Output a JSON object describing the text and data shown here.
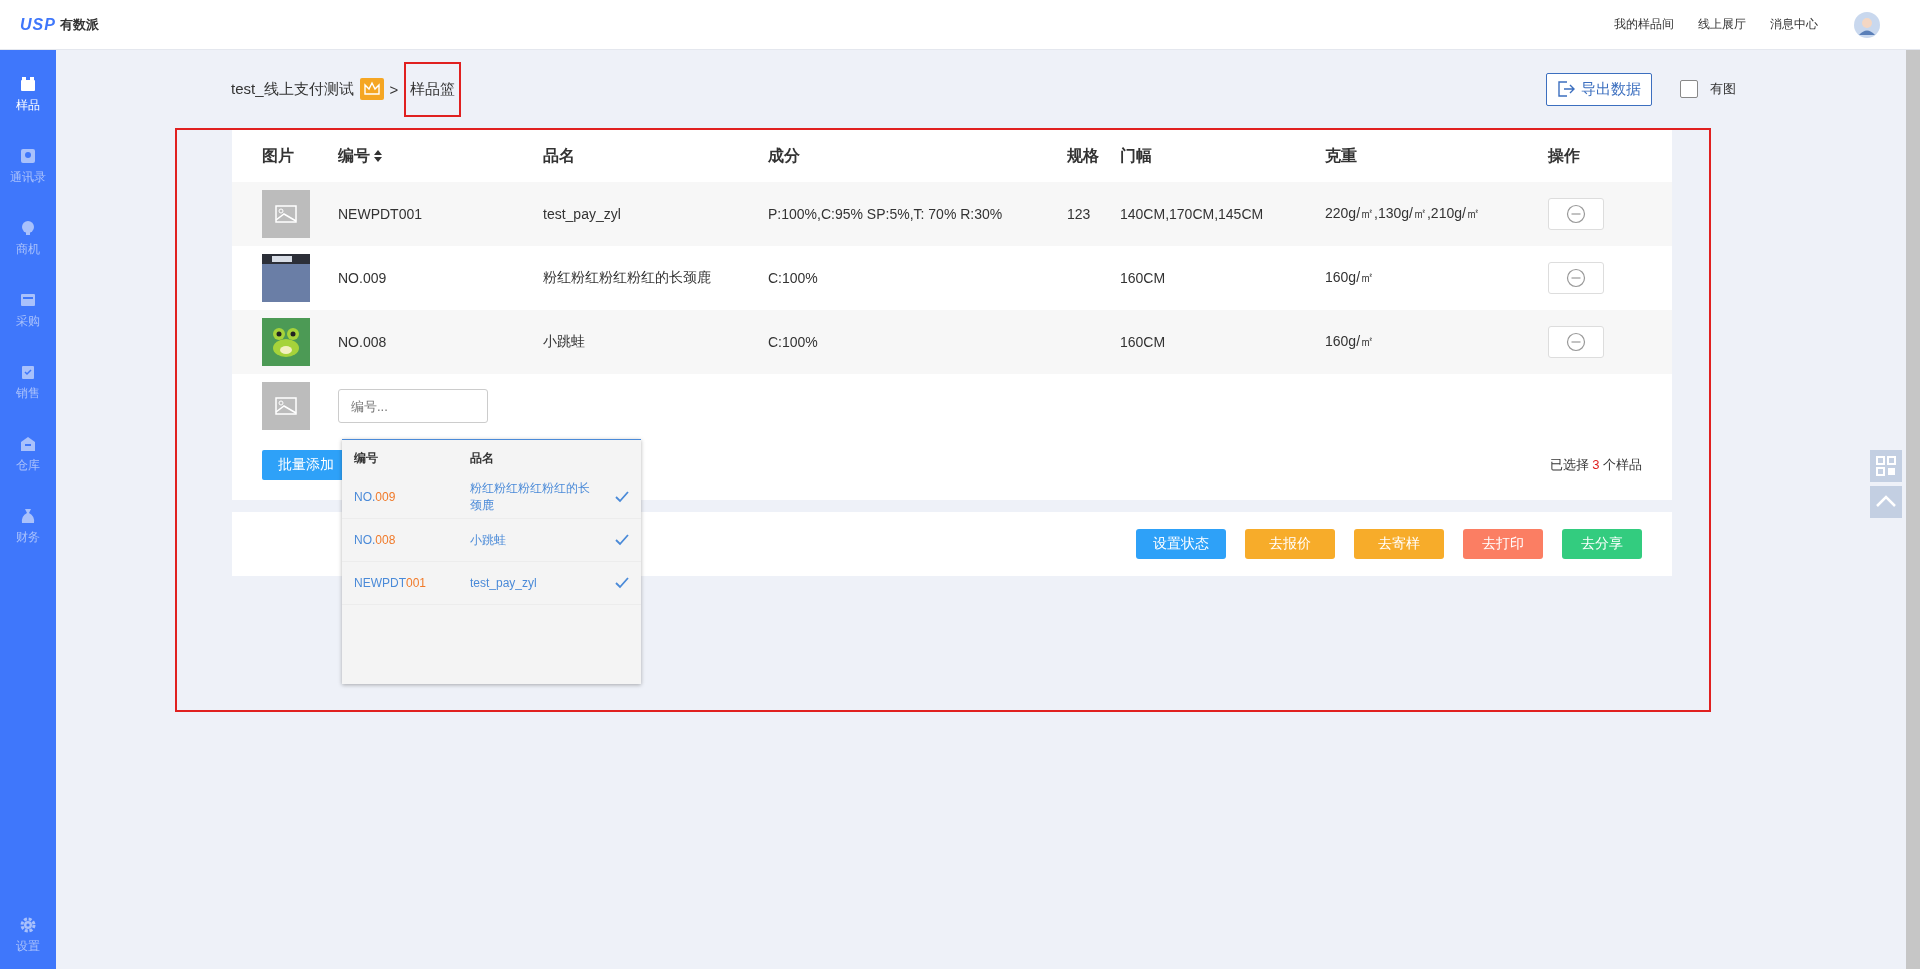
{
  "header": {
    "logo_mark": "USP",
    "logo_text": "有数派",
    "links": [
      "我的样品间",
      "线上展厅",
      "消息中心"
    ]
  },
  "sidebar": {
    "items": [
      {
        "label": "样品",
        "kind": "box",
        "selected": true
      },
      {
        "label": "通讯录",
        "kind": "contact",
        "selected": false
      },
      {
        "label": "商机",
        "kind": "bulb",
        "selected": false
      },
      {
        "label": "采购",
        "kind": "cart",
        "selected": false
      },
      {
        "label": "销售",
        "kind": "clipboard",
        "selected": false
      },
      {
        "label": "仓库",
        "kind": "warehouse",
        "selected": false
      },
      {
        "label": "财务",
        "kind": "moneybag",
        "selected": false
      }
    ],
    "settings": "设置"
  },
  "breadcrumb": {
    "project": "test_线上支付测试",
    "separator": ">",
    "current": "样品篮"
  },
  "toolbar": {
    "export_button": "导出数据",
    "has_image": {
      "label": "有图",
      "checked": false
    }
  },
  "table": {
    "columns": [
      {
        "label": "图片",
        "sortable": false
      },
      {
        "label": "编号",
        "sortable": true
      },
      {
        "label": "品名",
        "sortable": false
      },
      {
        "label": "成分",
        "sortable": false
      },
      {
        "label": "规格",
        "sortable": false
      },
      {
        "label": "门幅",
        "sortable": false
      },
      {
        "label": "克重",
        "sortable": false
      },
      {
        "label": "操作",
        "sortable": false
      }
    ],
    "rows": [
      {
        "kind": "placeholder",
        "code": "NEWPDT001",
        "name": "test_pay_zyl",
        "composition": "P:100%,C:95% SP:5%,T: 70% R:30%",
        "spec": "123",
        "width": "140CM,170CM,145CM",
        "weight": "220g/㎡,130g/㎡,210g/㎡"
      },
      {
        "kind": "fabric",
        "code": "NO.009",
        "name": "粉红粉红粉红粉红的长颈鹿",
        "composition": "C:100%",
        "spec": "",
        "width": "160CM",
        "weight": "160g/㎡"
      },
      {
        "kind": "frog",
        "code": "NO.008",
        "name": "小跳蛙",
        "composition": "C:100%",
        "spec": "",
        "width": "160CM",
        "weight": "160g/㎡"
      }
    ],
    "new_row": {
      "placeholder": "编号..."
    }
  },
  "dropdown": {
    "columns": [
      "编号",
      "品名"
    ],
    "items": [
      {
        "code_prefix": "NO.",
        "code_match": "009",
        "name": "粉红粉红粉红粉红的长颈鹿",
        "checked": true
      },
      {
        "code_prefix": "NO.",
        "code_match": "008",
        "name": "小跳蛙",
        "checked": true
      },
      {
        "code_prefix": "NEWPDT",
        "code_match": "001",
        "name": "test_pay_zyl",
        "checked": true
      }
    ]
  },
  "batch_add": "批量添加",
  "summary": {
    "prefix": "已选择",
    "count": "3",
    "suffix": "个样品"
  },
  "actions": [
    {
      "label": "设置状态",
      "color": "#2ea1f8"
    },
    {
      "label": "去报价",
      "color": "#f7ac2a"
    },
    {
      "label": "去寄样",
      "color": "#f7ac2a"
    },
    {
      "label": "去打印",
      "color": "#fb7e63"
    },
    {
      "label": "去分享",
      "color": "#33cc7f"
    }
  ]
}
